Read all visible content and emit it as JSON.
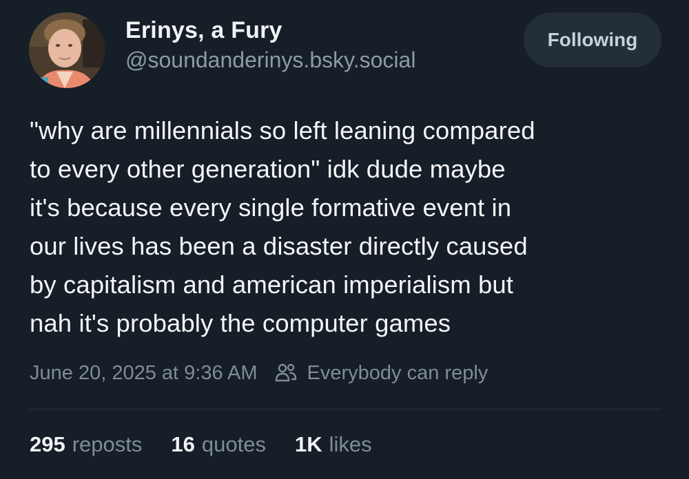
{
  "author": {
    "display_name": "Erinys, a Fury",
    "handle": "@soundanderinys.bsky.social",
    "avatar": "user-avatar-photo"
  },
  "follow_button": {
    "label": "Following"
  },
  "post": {
    "text": "\"why are millennials so left leaning compared\nto every other generation\" idk dude maybe\nit's because every single formative event in\nour lives has been a disaster directly caused\nby capitalism and american imperialism but\nnah it's probably the computer games",
    "timestamp": "June 20, 2025 at 9:36 AM",
    "reply_setting": "Everybody can reply",
    "reply_icon": "people-icon"
  },
  "stats": {
    "reposts_count": "295",
    "reposts_label": "reposts",
    "quotes_count": "16",
    "quotes_label": "quotes",
    "likes_count": "1K",
    "likes_label": "likes"
  },
  "colors": {
    "background": "#161e27",
    "text": "#f1f3f5",
    "muted": "#7f8c99",
    "button_bg": "#232e39"
  }
}
